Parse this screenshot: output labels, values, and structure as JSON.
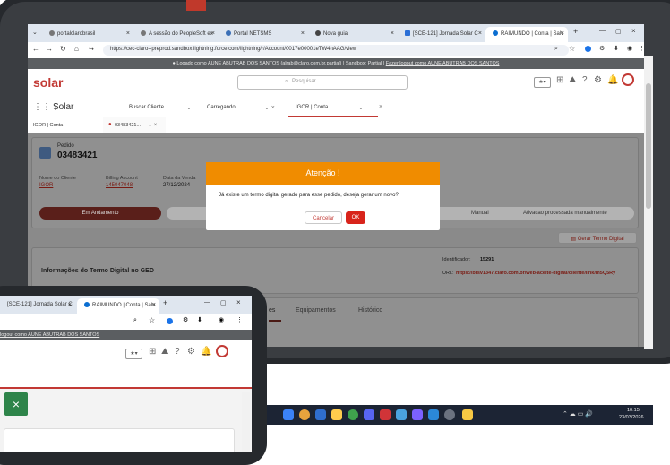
{
  "main_screen": {
    "browser": {
      "tabs": [
        {
          "label": "portalclarobrasil",
          "active": false
        },
        {
          "label": "A sessão do PeopleSoft ex",
          "active": false
        },
        {
          "label": "Portal NETSMS",
          "active": false
        },
        {
          "label": "Nova guia",
          "active": false
        },
        {
          "label": "[SCE-121] Jornada Solar C",
          "active": false
        },
        {
          "label": "RAIMUNDO | Conta | Salv",
          "active": true
        }
      ],
      "new_tab": "+",
      "url": "https://cec-claro--preprod.sandbox.lightning.force.com/lightning/r/Account/0017e00001eTW4nAAG/view"
    },
    "impersonation_bar": {
      "text": "Logado como AUNE ABUTRAB DOS SANTOS (alrab@claro.com.br.partial) | Sandbox: Partial |",
      "logout_link": "Fazer logout como AUNE ABUTRAB DOS SANTOS"
    },
    "header": {
      "logo": "solar",
      "search_placeholder": "Pesquisar..."
    },
    "nav": {
      "app_name": "Solar",
      "items": [
        {
          "label": "Buscar Cliente"
        },
        {
          "label": "Carregando..."
        },
        {
          "label": "IGOR | Conta"
        }
      ]
    },
    "subtabs": [
      {
        "label": "IGOR | Conta"
      },
      {
        "label": "03483421..."
      }
    ],
    "order": {
      "object_label": "Pedido",
      "number": "03483421",
      "fields": [
        {
          "label": "Nome do Cliente",
          "value": "IGOR"
        },
        {
          "label": "Billing Account",
          "value": "145047048"
        },
        {
          "label": "Data da Venda",
          "value": "27/12/2024"
        }
      ],
      "path": [
        {
          "label": "Em Andamento"
        },
        {
          "label": "Manual"
        },
        {
          "label": "Ativacao processada manualmente"
        }
      ],
      "gerar_button": "Gerar Termo Digital",
      "termo_title": "Informações do Termo Digital no GED",
      "identificador_label": "Identificador:",
      "identificador_value": "15291",
      "url_label": "URL:",
      "url_value": "https://brsv1347.claro.com.br/web-aceite-digital/cliente/link/m5Q5Ry",
      "detail_tabs": [
        {
          "label": "Equipamentos"
        },
        {
          "label": "Histórico"
        }
      ]
    },
    "modal": {
      "title": "Atenção !",
      "message": "Já existe um termo digital gerado para esse pedido, deseja gerar um novo?",
      "cancel": "Cancelar",
      "ok": "OK"
    }
  },
  "secondary_screen": {
    "tabs": [
      {
        "label": "[SCE-121] Jornada Solar C"
      },
      {
        "label": "RAIMUNDO | Conta | Salv"
      }
    ],
    "new_tab": "+",
    "impersonation_link": "logout como AUNE ABUTRAB DOS SANTOS",
    "toast_close": "×"
  },
  "taskbar": {
    "time": "10:15",
    "date": "23/03/2026"
  }
}
